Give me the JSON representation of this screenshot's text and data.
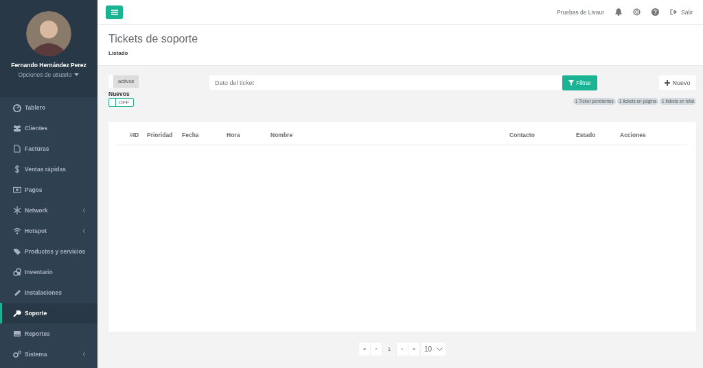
{
  "sidebar": {
    "user": {
      "name": "Fernando Hernández Perez",
      "options": "Opciones de usuario"
    },
    "items": [
      {
        "label": "Tablero",
        "selected": false,
        "expandable": false
      },
      {
        "label": "Clientes",
        "selected": false,
        "expandable": false
      },
      {
        "label": "Facturas",
        "selected": false,
        "expandable": false
      },
      {
        "label": "Ventas rápidas",
        "selected": false,
        "expandable": false
      },
      {
        "label": "Pagos",
        "selected": false,
        "expandable": false
      },
      {
        "label": "Network",
        "selected": false,
        "expandable": true
      },
      {
        "label": "Hotspot",
        "selected": false,
        "expandable": true
      },
      {
        "label": "Productos y servicios",
        "selected": false,
        "expandable": false
      },
      {
        "label": "Inventario",
        "selected": false,
        "expandable": false
      },
      {
        "label": "Instalaciones",
        "selected": false,
        "expandable": false
      },
      {
        "label": "Soporte",
        "selected": true,
        "expandable": false
      },
      {
        "label": "Reportes",
        "selected": false,
        "expandable": false
      },
      {
        "label": "Sistema",
        "selected": false,
        "expandable": true
      }
    ]
  },
  "topbar": {
    "company": "Pruebas de Livaur",
    "logout": "Salir"
  },
  "header": {
    "title": "Tickets de soporte",
    "subtitle": "Listado"
  },
  "filters": {
    "status_button": "activos",
    "new_label": "Nuevos",
    "new_switch": {
      "on": false,
      "label": "OFF"
    },
    "search": {
      "placeholder": "Dato del ticket"
    },
    "filter_button": "Filtrar",
    "new_button": "Nuevo",
    "badges": [
      "1 Ticket pendientes",
      "1 tickets en página",
      "1 tickets en total"
    ]
  },
  "table": {
    "columns": [
      "#ID",
      "Prioridad",
      "Fecha",
      "Hora",
      "Nombre",
      "Contacto",
      "Estado",
      "Acciones"
    ]
  },
  "pagination": {
    "buttons": [
      {
        "label": "«",
        "selected": false
      },
      {
        "label": "‹",
        "selected": false
      },
      {
        "label": "1",
        "selected": true
      },
      {
        "label": "›",
        "selected": false
      },
      {
        "label": "»",
        "selected": false
      }
    ],
    "page_size": "10"
  }
}
